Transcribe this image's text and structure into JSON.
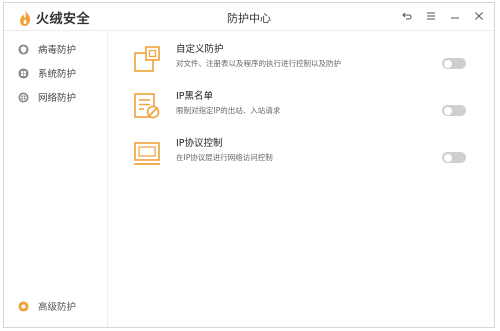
{
  "app": {
    "brand": "火绒安全",
    "window_title": "防护中心"
  },
  "titlebar": {
    "controls": [
      {
        "icon": "back-icon"
      },
      {
        "icon": "menu-icon"
      },
      {
        "icon": "minimize-icon"
      },
      {
        "icon": "close-icon"
      }
    ]
  },
  "sidebar": {
    "items": [
      {
        "label": "病毒防护",
        "icon": "shield-icon"
      },
      {
        "label": "系统防护",
        "icon": "windows-icon"
      },
      {
        "label": "网络防护",
        "icon": "globe-icon"
      }
    ],
    "advanced": {
      "label": "高级防护",
      "icon": "advanced-icon"
    }
  },
  "features": [
    {
      "title": "自定义防护",
      "desc": "对文件、注册表以及程序的执行进行控制以及防护",
      "icon": "custom-protect-icon",
      "enabled": false
    },
    {
      "title": "IP黑名单",
      "desc": "限制对指定IP的出站、入站请求",
      "icon": "ip-blacklist-icon",
      "enabled": false
    },
    {
      "title": "IP协议控制",
      "desc": "在IP协议层进行网络访问控制",
      "icon": "ip-protocol-icon",
      "enabled": false
    }
  ],
  "colors": {
    "accent": "#f0a23a",
    "toggle_off": "#cfcfcf",
    "sidebar_icon": "#8a8a8a"
  }
}
